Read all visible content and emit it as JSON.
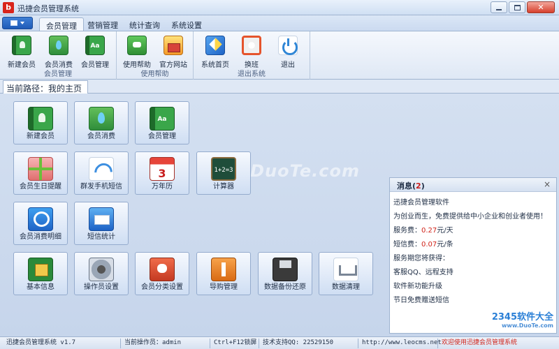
{
  "window": {
    "title": "迅捷会员管理系统",
    "logo_text": "b"
  },
  "tabs": [
    {
      "label": "会员管理",
      "active": true
    },
    {
      "label": "营销管理",
      "active": false
    },
    {
      "label": "统计查询",
      "active": false
    },
    {
      "label": "系统设置",
      "active": false
    }
  ],
  "ribbon": {
    "groups": [
      {
        "label": "会员管理",
        "buttons": [
          {
            "label": "新建会员",
            "icon": "book-user-icon"
          },
          {
            "label": "会员消费",
            "icon": "water-drop-icon"
          },
          {
            "label": "会员管理",
            "icon": "aa-book-icon"
          }
        ]
      },
      {
        "label": "使用帮助",
        "buttons": [
          {
            "label": "使用帮助",
            "icon": "chat-bubble-icon"
          },
          {
            "label": "官方网站",
            "icon": "website-icon"
          }
        ]
      },
      {
        "label": "退出系统",
        "buttons": [
          {
            "label": "系统首页",
            "icon": "home-icon"
          },
          {
            "label": "换班",
            "icon": "swap-icon"
          },
          {
            "label": "退出",
            "icon": "power-icon"
          }
        ]
      }
    ]
  },
  "breadcrumb": "当前路径：我的主页",
  "tiles": [
    {
      "label": "新建会员",
      "icon": "book-user-icon"
    },
    {
      "label": "会员消费",
      "icon": "water-drop-icon"
    },
    {
      "label": "会员管理",
      "icon": "aa-book-icon"
    },
    {
      "label": "会员生日提醒",
      "icon": "gift-icon"
    },
    {
      "label": "群发手机短信",
      "icon": "wifi-icon"
    },
    {
      "label": "万年历",
      "icon": "calendar-icon",
      "icon_text": "3"
    },
    {
      "label": "计算器",
      "icon": "calculator-icon",
      "icon_text": "1+2=3"
    },
    {
      "label": "会员消费明细",
      "icon": "magnifier-icon"
    },
    {
      "label": "短信统计",
      "icon": "mail-icon"
    },
    {
      "label": "基本信息",
      "icon": "chip-icon"
    },
    {
      "label": "操作员设置",
      "icon": "gear-icon"
    },
    {
      "label": "会员分类设置",
      "icon": "puzzle-icon"
    },
    {
      "label": "导购管理",
      "icon": "tree-icon"
    },
    {
      "label": "数据备份还原",
      "icon": "disk-icon"
    },
    {
      "label": "数据清理",
      "icon": "cart-icon"
    }
  ],
  "watermark": "www.DuoTe.com",
  "messages": {
    "title": "消息",
    "count": "2",
    "lines": [
      {
        "text": "迅捷会员管理软件"
      },
      {
        "text": "为创业而生，免费提供给中小企业和创业者使用！"
      },
      {
        "prefix": "服务费：",
        "value": "0.27",
        "suffix": "元/天"
      },
      {
        "prefix": "短信费：",
        "value": "0.07",
        "suffix": "元/条"
      },
      {
        "text": "服务期您将获得："
      },
      {
        "text": "客服QQ、远程支持"
      },
      {
        "text": "软件新功能升级"
      },
      {
        "text": "节日免费赠送短信"
      }
    ],
    "brand": "2345软件大全",
    "brand_url": "www.DuoTe.com"
  },
  "status": {
    "version": "迅捷会员管理系统 v1.7",
    "operator": "当前操作员：admin",
    "lock": "Ctrl+F12锁屏",
    "support": "技术支持QQ:  22529150",
    "url": "http://www.leocms.net",
    "welcome": "欢迎使用迅捷会员管理系统"
  }
}
